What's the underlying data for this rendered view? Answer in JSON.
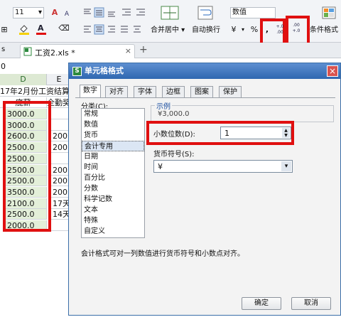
{
  "ribbon": {
    "font_size": "11",
    "font_size_up": "A",
    "font_size_down": "A",
    "merge_center": "合并居中",
    "auto_wrap": "自动换行",
    "number_format": "数值",
    "percent": "%",
    "increase_decimal": "+.0\n.00",
    "decrease_decimal": ".00\n+.0",
    "conditional_format": "条件格式"
  },
  "tabs": {
    "file_tab": "工资2.xls *",
    "add_tab": "+"
  },
  "namebox": {
    "value": "0"
  },
  "sheet": {
    "col_d": "D",
    "col_e": "E",
    "title_row": "17年2月份工资结算",
    "header_d": "底薪",
    "header_e": "全勤奖",
    "rows": [
      {
        "d": "3000.0",
        "e": ""
      },
      {
        "d": "3000.0",
        "e": ""
      },
      {
        "d": "2600.0",
        "e": "200"
      },
      {
        "d": "2500.0",
        "e": "200"
      },
      {
        "d": "2500.0",
        "e": ""
      },
      {
        "d": "2500.0",
        "e": "200"
      },
      {
        "d": "2500.0",
        "e": "200"
      },
      {
        "d": "3500.0",
        "e": "200"
      },
      {
        "d": "2100.0",
        "e": "17天"
      },
      {
        "d": "2500.0",
        "e": "14天"
      },
      {
        "d": "2000.0",
        "e": ""
      }
    ]
  },
  "dialog": {
    "title": "单元格格式",
    "tabs": [
      "数字",
      "对齐",
      "字体",
      "边框",
      "图案",
      "保护"
    ],
    "category_label": "分类(C):",
    "categories": [
      "常规",
      "数值",
      "货币",
      "会计专用",
      "日期",
      "时间",
      "百分比",
      "分数",
      "科学记数",
      "文本",
      "特殊",
      "自定义"
    ],
    "selected_category": "会计专用",
    "sample_label": "示例",
    "sample_value": "¥3,000.0",
    "decimal_label": "小数位数(D):",
    "decimal_value": "1",
    "currency_label": "货币符号(S):",
    "currency_value": "¥",
    "description": "会计格式可对一列数值进行货币符号和小数点对齐。",
    "ok": "确定",
    "cancel": "取消"
  },
  "colors": {
    "highlight_red": "#e01010",
    "title_bar": "#2f67b0",
    "selection_fill": "#e3efd9"
  }
}
